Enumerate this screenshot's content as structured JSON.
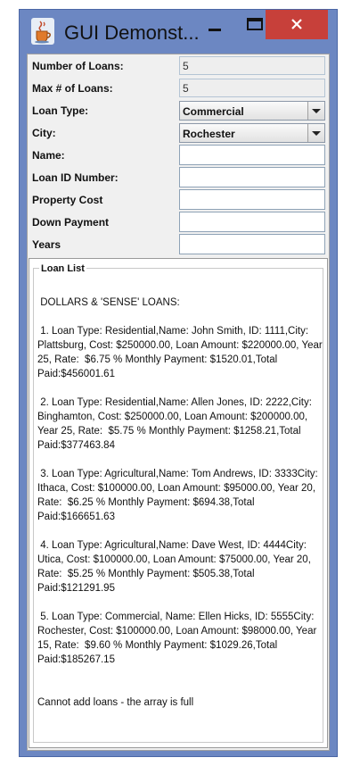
{
  "window": {
    "title": "GUI Demonst..."
  },
  "form": {
    "number_of_loans_label": "Number of Loans:",
    "number_of_loans_value": "5",
    "max_loans_label": "Max # of Loans:",
    "max_loans_value": "5",
    "loan_type_label": "Loan Type:",
    "loan_type_value": "Commercial",
    "city_label": "City:",
    "city_value": "Rochester",
    "name_label": "Name:",
    "name_value": "",
    "loan_id_label": "Loan ID Number:",
    "loan_id_value": "",
    "property_cost_label": "Property Cost",
    "property_cost_value": "",
    "down_payment_label": "Down Payment",
    "down_payment_value": "",
    "years_label": "Years",
    "years_value": ""
  },
  "loan_list": {
    "title": "Loan List",
    "header": " DOLLARS & 'SENSE' LOANS:",
    "entries": [
      " 1. Loan Type: Residential,Name: John Smith, ID: 1111,City: Plattsburg, Cost: $250000.00, Loan Amount: $220000.00, Year 25, Rate:  $6.75 % Monthly Payment: $1520.01,Total Paid:$456001.61",
      " 2. Loan Type: Residential,Name: Allen Jones, ID: 2222,City: Binghamton, Cost: $250000.00, Loan Amount: $200000.00, Year 25, Rate:  $5.75 % Monthly Payment: $1258.21,Total Paid:$377463.84",
      " 3. Loan Type: Agricultural,Name: Tom Andrews, ID: 3333City: Ithaca, Cost: $100000.00, Loan Amount: $95000.00, Year 20, Rate:  $6.25 % Monthly Payment: $694.38,Total Paid:$166651.63",
      " 4. Loan Type: Agricultural,Name: Dave West, ID: 4444City: Utica, Cost: $100000.00, Loan Amount: $75000.00, Year 20, Rate:  $5.25 % Monthly Payment: $505.38,Total Paid:$121291.95",
      " 5. Loan Type: Commercial, Name: Ellen Hicks, ID: 5555City: Rochester, Cost: $100000.00, Loan Amount: $98000.00, Year 15, Rate:  $9.60 % Monthly Payment: $1029.26,Total Paid:$185267.15"
    ],
    "status": "Cannot add loans - the array is full"
  },
  "icons": {
    "app": "java-cup-icon",
    "minimize": "minimize-icon",
    "maximize": "maximize-icon",
    "close": "close-icon",
    "dropdown": "chevron-down-icon"
  },
  "colors": {
    "titlebar": "#6c87c2",
    "close_button": "#c7403a",
    "panel_background": "#f0f0f0"
  }
}
